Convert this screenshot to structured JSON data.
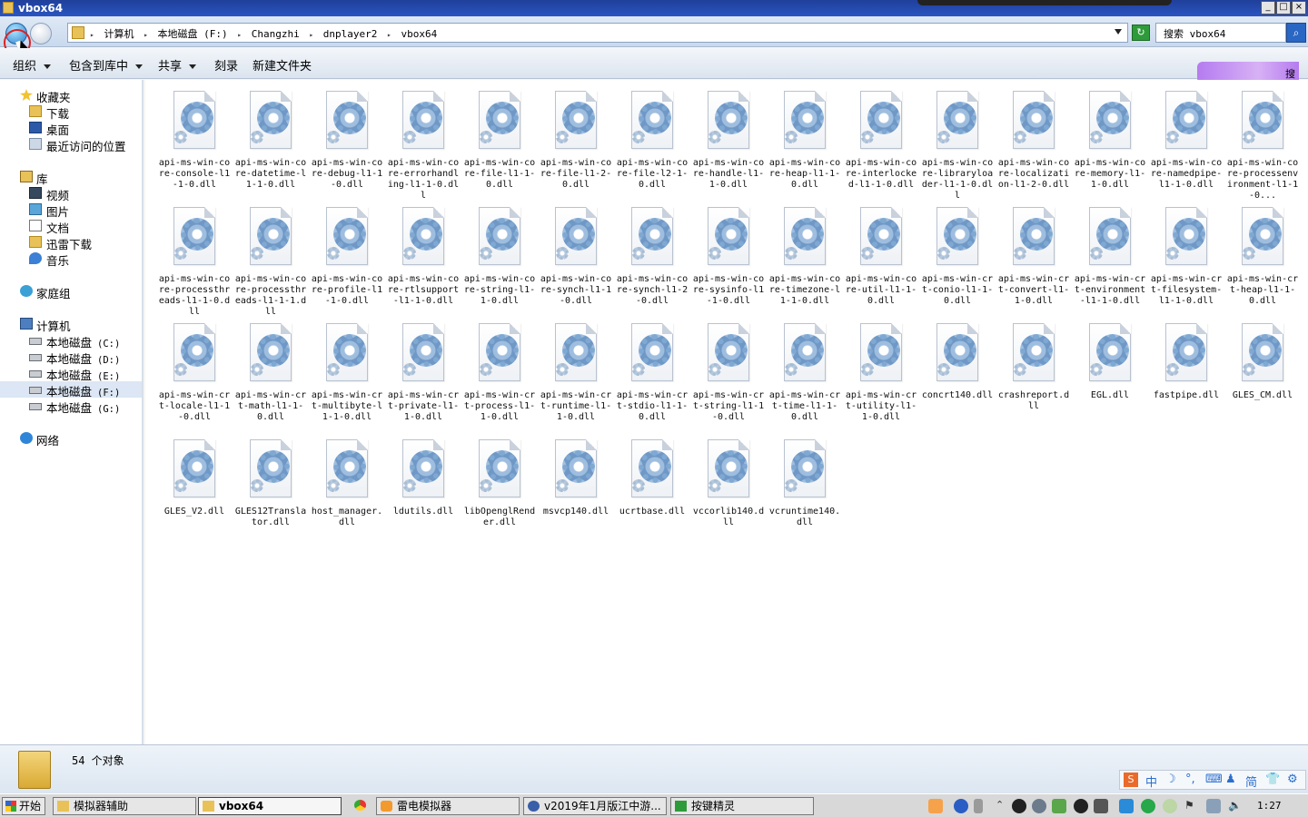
{
  "window": {
    "title": "vbox64",
    "controls": [
      "_",
      "□",
      "×"
    ]
  },
  "address": {
    "breadcrumb": [
      "计算机",
      "本地磁盘 (F:)",
      "Changzhi",
      "dnplayer2",
      "vbox64"
    ],
    "search_placeholder": "搜索 vbox64"
  },
  "toolbar": {
    "organize": "组织",
    "include_library": "包含到库中",
    "share": "共享",
    "burn": "刻录",
    "new_folder": "新建文件夹",
    "overlay_label": "搜"
  },
  "nav": {
    "favorites": "收藏夹",
    "downloads": "下载",
    "desktop": "桌面",
    "recent": "最近访问的位置",
    "libraries": "库",
    "videos": "视频",
    "pictures": "图片",
    "documents": "文档",
    "xunlei": "迅雷下载",
    "music": "音乐",
    "homegroup": "家庭组",
    "computer": "计算机",
    "drives": [
      {
        "name": "本地磁盘",
        "letter": "(C:)"
      },
      {
        "name": "本地磁盘",
        "letter": "(D:)"
      },
      {
        "name": "本地磁盘",
        "letter": "(E:)"
      },
      {
        "name": "本地磁盘",
        "letter": "(F:)"
      },
      {
        "name": "本地磁盘",
        "letter": "(G:)"
      }
    ],
    "network": "网络"
  },
  "files": [
    "api-ms-win-core-console-l1-1-0.dll",
    "api-ms-win-core-datetime-l1-1-0.dll",
    "api-ms-win-core-debug-l1-1-0.dll",
    "api-ms-win-core-errorhandling-l1-1-0.dll",
    "api-ms-win-core-file-l1-1-0.dll",
    "api-ms-win-core-file-l1-2-0.dll",
    "api-ms-win-core-file-l2-1-0.dll",
    "api-ms-win-core-handle-l1-1-0.dll",
    "api-ms-win-core-heap-l1-1-0.dll",
    "api-ms-win-core-interlocked-l1-1-0.dll",
    "api-ms-win-core-libraryloader-l1-1-0.dll",
    "api-ms-win-core-localization-l1-2-0.dll",
    "api-ms-win-core-memory-l1-1-0.dll",
    "api-ms-win-core-namedpipe-l1-1-0.dll",
    "api-ms-win-core-processenvironment-l1-1-0...",
    "api-ms-win-core-processthreads-l1-1-0.dll",
    "api-ms-win-core-processthreads-l1-1-1.dll",
    "api-ms-win-core-profile-l1-1-0.dll",
    "api-ms-win-core-rtlsupport-l1-1-0.dll",
    "api-ms-win-core-string-l1-1-0.dll",
    "api-ms-win-core-synch-l1-1-0.dll",
    "api-ms-win-core-synch-l1-2-0.dll",
    "api-ms-win-core-sysinfo-l1-1-0.dll",
    "api-ms-win-core-timezone-l1-1-0.dll",
    "api-ms-win-core-util-l1-1-0.dll",
    "api-ms-win-crt-conio-l1-1-0.dll",
    "api-ms-win-crt-convert-l1-1-0.dll",
    "api-ms-win-crt-environment-l1-1-0.dll",
    "api-ms-win-crt-filesystem-l1-1-0.dll",
    "api-ms-win-crt-heap-l1-1-0.dll",
    "api-ms-win-crt-locale-l1-1-0.dll",
    "api-ms-win-crt-math-l1-1-0.dll",
    "api-ms-win-crt-multibyte-l1-1-0.dll",
    "api-ms-win-crt-private-l1-1-0.dll",
    "api-ms-win-crt-process-l1-1-0.dll",
    "api-ms-win-crt-runtime-l1-1-0.dll",
    "api-ms-win-crt-stdio-l1-1-0.dll",
    "api-ms-win-crt-string-l1-1-0.dll",
    "api-ms-win-crt-time-l1-1-0.dll",
    "api-ms-win-crt-utility-l1-1-0.dll",
    "concrt140.dll",
    "crashreport.dll",
    "EGL.dll",
    "fastpipe.dll",
    "GLES_CM.dll",
    "GLES_V2.dll",
    "GLES12Translator.dll",
    "host_manager.dll",
    "ldutils.dll",
    "libOpenglRender.dll",
    "msvcp140.dll",
    "ucrtbase.dll",
    "vccorlib140.dll",
    "vcruntime140.dll"
  ],
  "details": {
    "count_text": "54 个对象"
  },
  "ime": [
    "中",
    "简"
  ],
  "taskbar": {
    "start": "开始",
    "tasks": [
      "模拟器辅助",
      "vbox64",
      "雷电模拟器",
      "v2019年1月版江中游...",
      "按键精灵"
    ],
    "clock": "1:27"
  },
  "colors": {
    "titlebar": "#2a55c2",
    "selection": "#dce6f4"
  }
}
